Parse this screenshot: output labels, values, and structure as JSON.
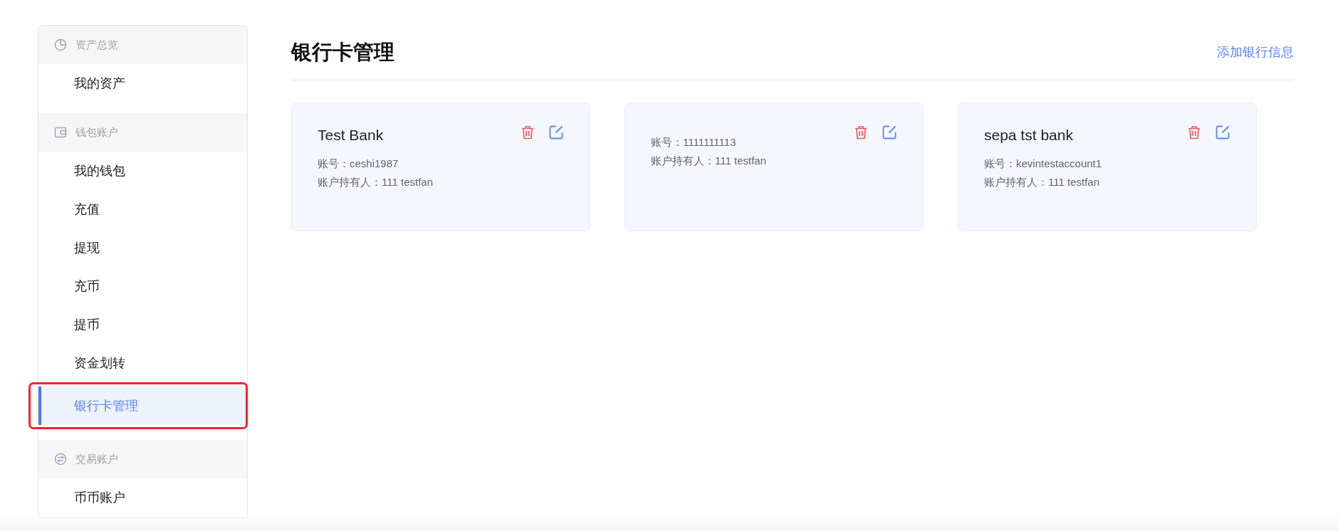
{
  "sidebar": {
    "groups": [
      {
        "title": "资产总览",
        "items": [
          {
            "label": "我的资产",
            "selected": false
          }
        ]
      },
      {
        "title": "钱包账户",
        "items": [
          {
            "label": "我的钱包",
            "selected": false
          },
          {
            "label": "充值",
            "selected": false
          },
          {
            "label": "提现",
            "selected": false
          },
          {
            "label": "充币",
            "selected": false
          },
          {
            "label": "提币",
            "selected": false
          },
          {
            "label": "资金划转",
            "selected": false
          },
          {
            "label": "银行卡管理",
            "selected": true
          }
        ]
      },
      {
        "title": "交易账户",
        "items": [
          {
            "label": "币币账户",
            "selected": false
          }
        ]
      }
    ]
  },
  "page_title": "银行卡管理",
  "add_link": "添加银行信息",
  "cards": [
    {
      "bank_name": "Test Bank",
      "account": "账号：ceshi1987",
      "holder": "账户持有人：111 testfan"
    },
    {
      "account": "账号：1111111113",
      "holder": "账户持有人：111 testfan"
    },
    {
      "bank_name": "sepa tst bank",
      "account": "账号：kevintestaccount1",
      "holder": "账户持有人：111 testfan"
    }
  ]
}
